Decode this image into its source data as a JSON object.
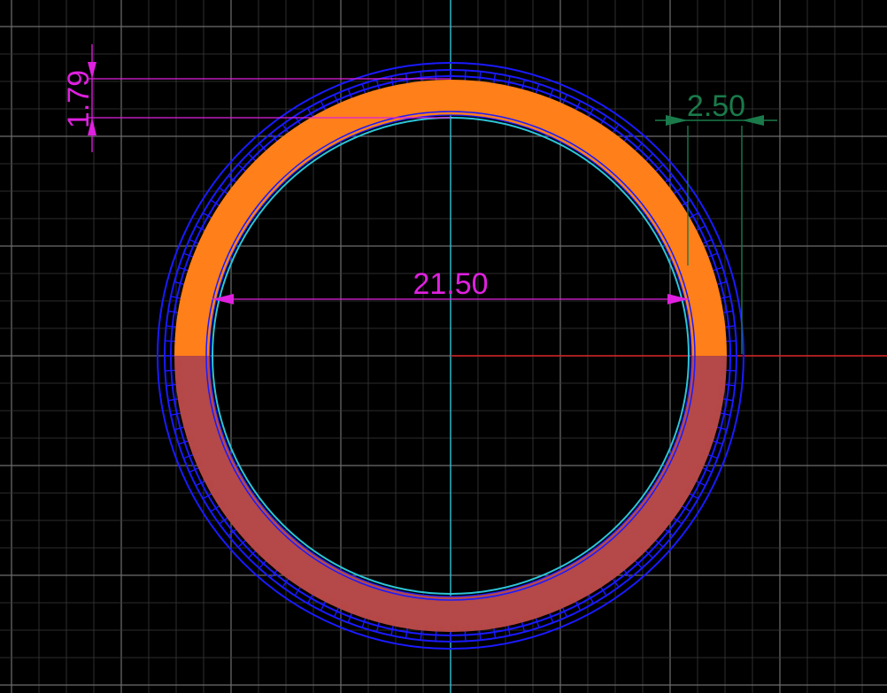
{
  "drawing": {
    "dimensions": {
      "inner_diameter": "21.50",
      "wall_thickness": "1.79",
      "outer_offset": "2.50"
    }
  },
  "colors": {
    "background": "#000000",
    "grid_minor": "#3a3a3a",
    "grid_major": "#6e6e6e",
    "axis_y": "#2ec4d8",
    "axis_x": "#d42020",
    "outer_ring": "#1a1aff",
    "inner_ring": "#2ec4d8",
    "band_upper": "#ff7f1a",
    "band_lower": "#b54848",
    "dim_magenta": "#e020e0",
    "dim_green": "#1a7a4a"
  }
}
